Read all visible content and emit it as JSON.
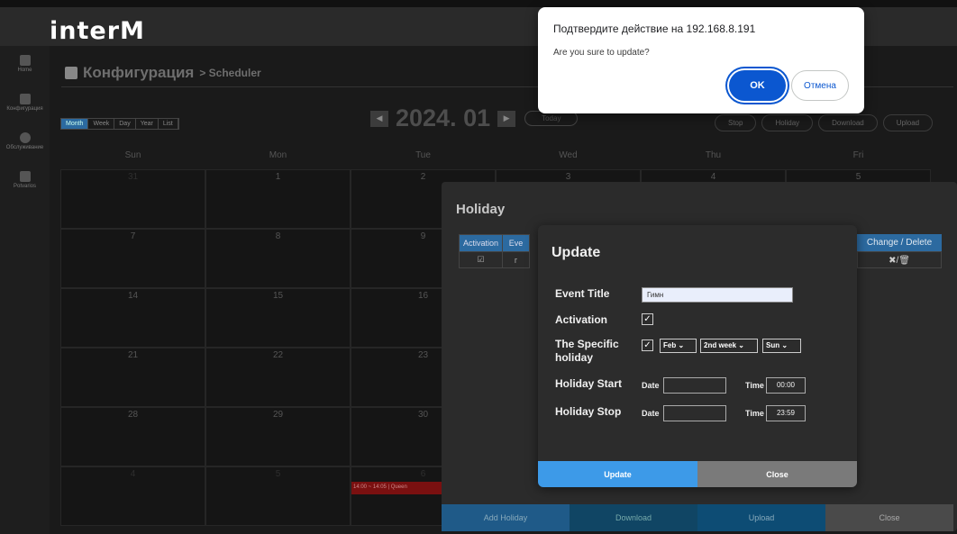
{
  "brand": {
    "logo": "interM"
  },
  "sidebar": {
    "items": [
      {
        "label": "Home",
        "icon": "home-icon"
      },
      {
        "label": "Конфигурация",
        "icon": "config-icon"
      },
      {
        "label": "Обслуживание",
        "icon": "maintenance-icon"
      },
      {
        "label": "Potvarios",
        "icon": "exit-icon"
      }
    ]
  },
  "header": {
    "title": "Конфигурация",
    "breadcrumb": "> Scheduler"
  },
  "calendar": {
    "views": [
      "Month",
      "Week",
      "Day",
      "Year",
      "List"
    ],
    "active_view": "Month",
    "month_label": "2024. 01",
    "prev_icon": "◀",
    "next_icon": "▶",
    "today_label": "Today",
    "actions": [
      "Stop",
      "Holiday",
      "Download",
      "Upload"
    ],
    "weekdays": [
      "Sun",
      "Mon",
      "Tue",
      "Wed",
      "Thu",
      "Fri"
    ],
    "weeks": [
      [
        "31",
        "1",
        "2",
        "3",
        "4",
        "5"
      ],
      [
        "7",
        "8",
        "9",
        "",
        "",
        ""
      ],
      [
        "14",
        "15",
        "16",
        "",
        "",
        ""
      ],
      [
        "21",
        "22",
        "23",
        "",
        "",
        ""
      ],
      [
        "28",
        "29",
        "30",
        "",
        "",
        ""
      ],
      [
        "4",
        "5",
        "6",
        "",
        "",
        ""
      ]
    ],
    "event_text": "14:00 ~ 14:05 | Queen"
  },
  "holiday_modal": {
    "title": "Holiday",
    "columns": [
      "Activation",
      "Eve"
    ],
    "row_check": "☑",
    "row_partial": "г",
    "change_header": "Change / Delete",
    "change_icons": "✖/🗑",
    "footer": [
      "Add Holiday",
      "Download",
      "Upload",
      "Close"
    ]
  },
  "update_modal": {
    "title": "Update",
    "event_title_label": "Event Title",
    "event_title_value": "Гимн",
    "activation_label": "Activation",
    "specific_label_1": "The Specific",
    "specific_label_2": "holiday",
    "month_select": "Feb",
    "week_select": "2nd week",
    "day_select": "Sun",
    "start_label": "Holiday Start",
    "stop_label": "Holiday Stop",
    "date_label": "Date",
    "time_label": "Time",
    "start_time": "00:00",
    "stop_time": "23:59",
    "check_mark": "✓",
    "caret": "⌄",
    "update_button": "Update",
    "close_button": "Close"
  },
  "alert": {
    "title": "Подтвердите действие на 192.168.8.191",
    "message": "Are you sure to update?",
    "ok": "OK",
    "cancel": "Отмена"
  }
}
